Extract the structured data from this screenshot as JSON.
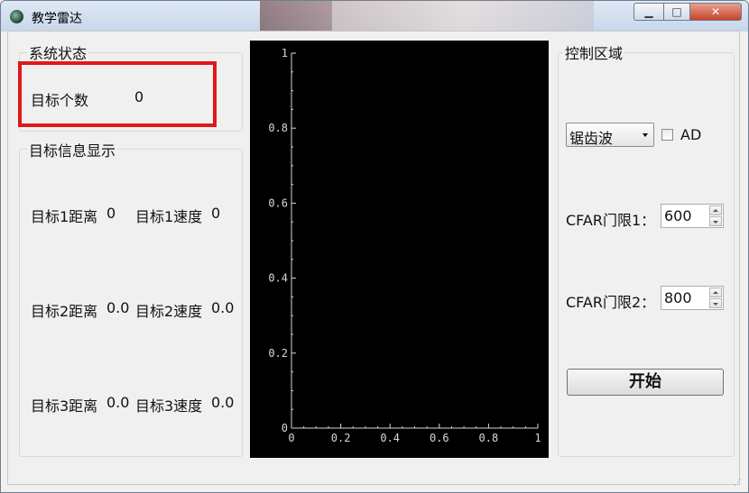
{
  "window": {
    "title": "教学雷达",
    "minimize": "▁",
    "maximize": "□",
    "close": "✕"
  },
  "status_group": {
    "title": "系统状态",
    "target_count_label": "目标个数",
    "target_count_value": "0"
  },
  "info_group": {
    "title": "目标信息显示",
    "rows": [
      {
        "dist_label": "目标1距离",
        "dist_value": "0",
        "speed_label": "目标1速度",
        "speed_value": "0"
      },
      {
        "dist_label": "目标2距离",
        "dist_value": "0.0",
        "speed_label": "目标2速度",
        "speed_value": "0.0"
      },
      {
        "dist_label": "目标3距离",
        "dist_value": "0.0",
        "speed_label": "目标3速度",
        "speed_value": "0.0"
      }
    ]
  },
  "control_group": {
    "title": "控制区域",
    "waveform_selected": "锯齿波",
    "ad_label": "AD",
    "ad_checked": false,
    "cfar1_label": "CFAR门限1：",
    "cfar1_value": "600",
    "cfar2_label": "CFAR门限2：",
    "cfar2_value": "800",
    "start_button": "开始"
  },
  "chart_data": {
    "type": "line",
    "series": [],
    "xlim": [
      0,
      1
    ],
    "ylim": [
      0,
      1
    ],
    "x_ticks": [
      "0",
      "0.2",
      "0.4",
      "0.6",
      "0.8",
      "1"
    ],
    "y_ticks": [
      "0",
      "0.2",
      "0.4",
      "0.6",
      "0.8",
      "1"
    ],
    "background": "#000000",
    "axis_color": "#d8d8d8",
    "grid": false
  },
  "colors": {
    "highlight_box": "#e01818"
  }
}
